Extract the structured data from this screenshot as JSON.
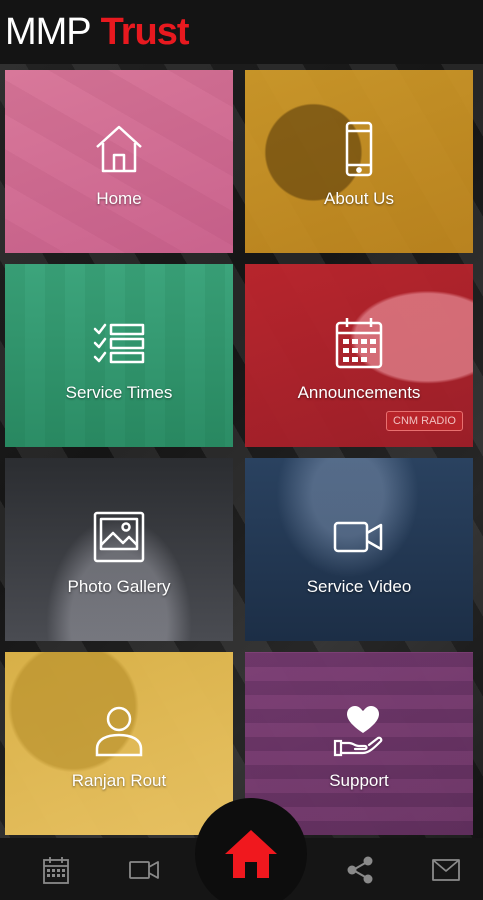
{
  "header": {
    "title_part1": "MMP",
    "title_part2": "Trust"
  },
  "colors": {
    "accent": "#e8191f",
    "header_bg": "#141414",
    "home_tile": "#d8759a",
    "about_tile": "#d9a12a",
    "service_times_tile": "#3aa87e",
    "announcements_tile": "#c0262e",
    "gallery_tile": "#3a3c40",
    "video_tile": "#27405e",
    "ranjan_tile": "#e2b84a",
    "support_tile": "#7a3e78"
  },
  "tiles": [
    {
      "label": "Home",
      "icon": "house-icon"
    },
    {
      "label": "About Us",
      "icon": "smartphone-icon"
    },
    {
      "label": "Service Times",
      "icon": "checklist-icon"
    },
    {
      "label": "Announcements",
      "icon": "calendar-icon"
    },
    {
      "label": "Photo Gallery",
      "icon": "image-icon"
    },
    {
      "label": "Service Video",
      "icon": "video-camera-icon"
    },
    {
      "label": "Ranjan Rout",
      "icon": "user-icon"
    },
    {
      "label": "Support",
      "icon": "heart-hand-icon"
    }
  ],
  "announcements_badge": "CNM RADIO",
  "bottom_nav": [
    {
      "icon": "calendar-icon"
    },
    {
      "icon": "video-camera-icon"
    },
    {
      "icon": "home-icon"
    },
    {
      "icon": "share-icon"
    },
    {
      "icon": "mail-icon"
    }
  ]
}
